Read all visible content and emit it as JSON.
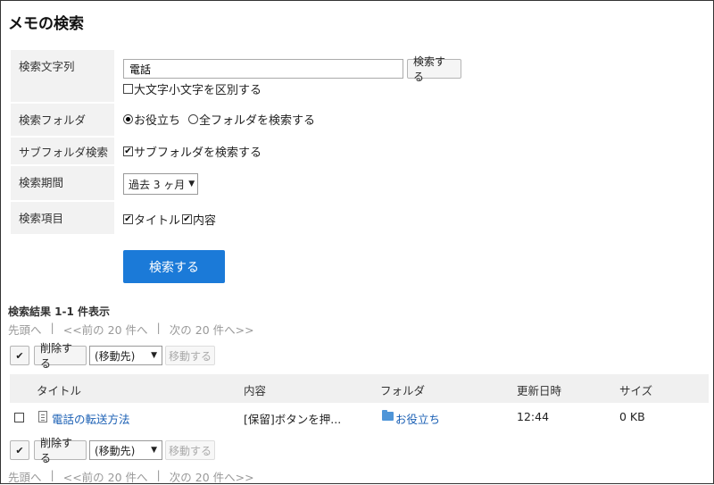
{
  "page": {
    "title": "メモの検索"
  },
  "form": {
    "keyword_label": "検索文字列",
    "keyword_value": "電話",
    "search_button": "検索する",
    "case_sensitive_label": "大文字小文字を区別する",
    "case_sensitive_checked": false,
    "folder_label": "検索フォルダ",
    "folder_options": [
      {
        "label": "お役立ち",
        "selected": true
      },
      {
        "label": "全フォルダを検索する",
        "selected": false
      }
    ],
    "subfolder_label": "サブフォルダ検索",
    "subfolder_option": "サブフォルダを検索する",
    "subfolder_checked": true,
    "period_label": "検索期間",
    "period_value": "過去 3 ヶ月",
    "items_label": "検索項目",
    "item_options": [
      {
        "label": "タイトル",
        "checked": true
      },
      {
        "label": "内容",
        "checked": true
      }
    ],
    "submit_button": "検索する"
  },
  "results": {
    "summary": "検索結果 1-1 件表示",
    "pager": {
      "first": "先頭へ",
      "prev": "<<前の 20 件へ",
      "next": "次の 20 件へ>>",
      "separator": "|"
    },
    "actions": {
      "check_all": "✔",
      "delete": "削除する",
      "move_target": "(移動先)",
      "move": "移動する"
    },
    "columns": {
      "title": "タイトル",
      "content": "内容",
      "folder": "フォルダ",
      "updated": "更新日時",
      "size": "サイズ"
    },
    "rows": [
      {
        "title": "電話の転送方法",
        "content": "[保留]ボタンを押...",
        "folder": "お役立ち",
        "updated": "12:44",
        "size": "0 KB"
      }
    ]
  },
  "icons": {
    "memo": "memo-icon",
    "folder": "folder-icon"
  },
  "colors": {
    "primary_button": "#1b7ad8",
    "link": "#1a5fb4",
    "folder": "#4f95d8"
  }
}
